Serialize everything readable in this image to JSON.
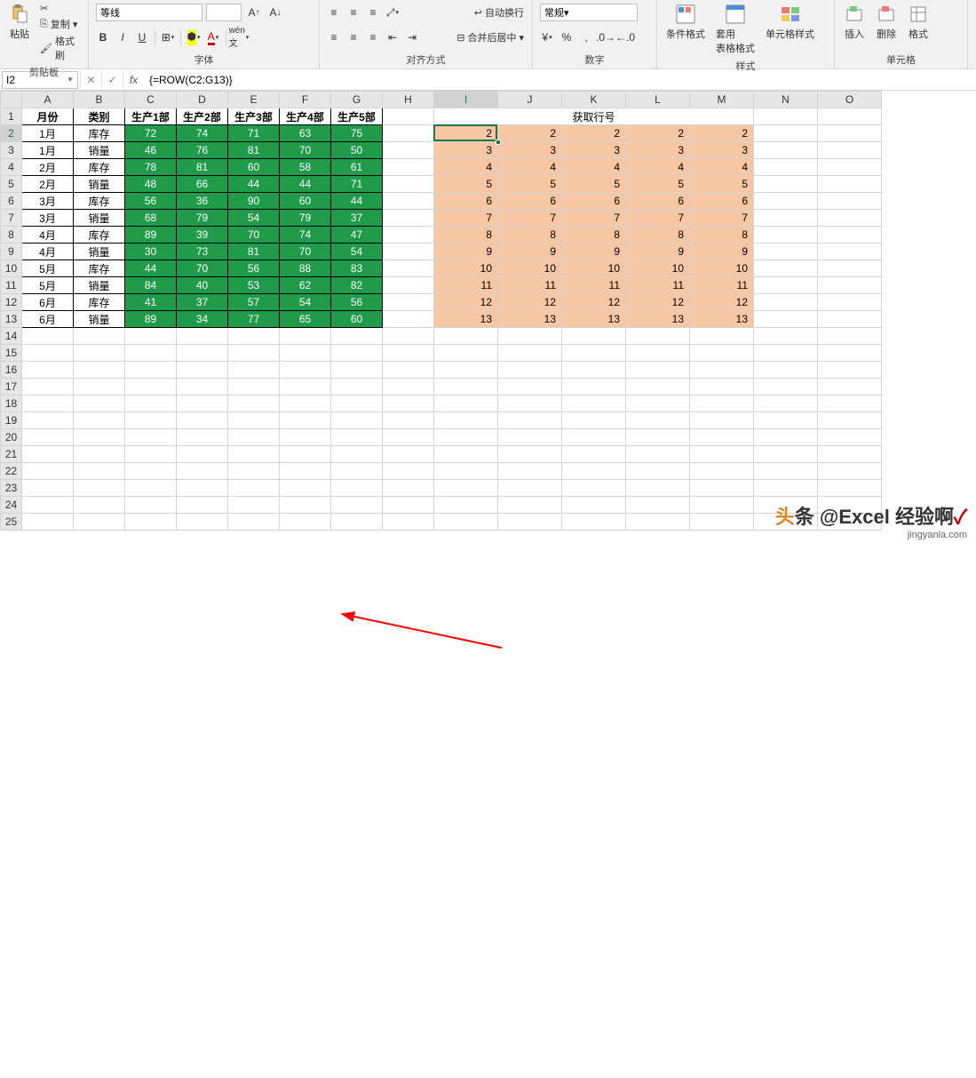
{
  "ribbon": {
    "groups": {
      "clipboard": {
        "label": "剪贴板",
        "paste": "粘贴",
        "copy": "复制",
        "format_painter": "格式刷"
      },
      "font": {
        "label": "字体",
        "family": "等线",
        "bold": "B",
        "italic": "I",
        "underline": "U"
      },
      "alignment": {
        "label": "对齐方式",
        "wrap": "自动换行",
        "merge": "合并后居中"
      },
      "number": {
        "label": "数字",
        "format": "常规"
      },
      "styles": {
        "label": "样式",
        "cond_format": "条件格式",
        "format_table": "套用\n表格格式",
        "cell_styles": "单元格样式"
      },
      "cells": {
        "label": "单元格",
        "insert": "插入",
        "delete": "删除",
        "format": "格式"
      }
    }
  },
  "formula_bar": {
    "name_box": "I2",
    "formula": "{=ROW(C2:G13)}"
  },
  "columns": [
    "A",
    "B",
    "C",
    "D",
    "E",
    "F",
    "G",
    "H",
    "I",
    "J",
    "K",
    "L",
    "M",
    "N",
    "O"
  ],
  "row_count": 25,
  "headers": {
    "A": "月份",
    "B": "类别",
    "C": "生产1部",
    "D": "生产2部",
    "E": "生产3部",
    "F": "生产4部",
    "G": "生产5部"
  },
  "merged_title": "获取行号",
  "table_rows": [
    {
      "m": "1月",
      "t": "库存",
      "v": [
        72,
        74,
        71,
        63,
        75
      ]
    },
    {
      "m": "1月",
      "t": "销量",
      "v": [
        46,
        76,
        81,
        70,
        50
      ]
    },
    {
      "m": "2月",
      "t": "库存",
      "v": [
        78,
        81,
        60,
        58,
        61
      ]
    },
    {
      "m": "2月",
      "t": "销量",
      "v": [
        48,
        66,
        44,
        44,
        71
      ]
    },
    {
      "m": "3月",
      "t": "库存",
      "v": [
        56,
        36,
        90,
        60,
        44
      ]
    },
    {
      "m": "3月",
      "t": "销量",
      "v": [
        68,
        79,
        54,
        79,
        37
      ]
    },
    {
      "m": "4月",
      "t": "库存",
      "v": [
        89,
        39,
        70,
        74,
        47
      ]
    },
    {
      "m": "4月",
      "t": "销量",
      "v": [
        30,
        73,
        81,
        70,
        54
      ]
    },
    {
      "m": "5月",
      "t": "库存",
      "v": [
        44,
        70,
        56,
        88,
        83
      ]
    },
    {
      "m": "5月",
      "t": "销量",
      "v": [
        84,
        40,
        53,
        62,
        82
      ]
    },
    {
      "m": "6月",
      "t": "库存",
      "v": [
        41,
        37,
        57,
        54,
        56
      ]
    },
    {
      "m": "6月",
      "t": "销量",
      "v": [
        89,
        34,
        77,
        65,
        60
      ]
    }
  ],
  "row_numbers": [
    2,
    3,
    4,
    5,
    6,
    7,
    8,
    9,
    10,
    11,
    12,
    13
  ],
  "watermark": {
    "main": "头条 @Excel 经验啊",
    "sub": "jingyanla.com"
  }
}
